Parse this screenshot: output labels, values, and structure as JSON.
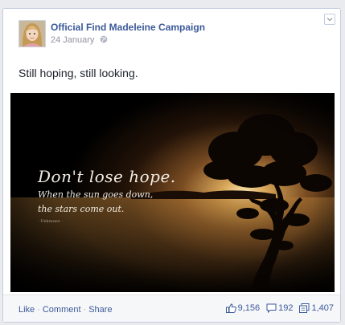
{
  "post": {
    "page_name": "Official Find Madeleine Campaign",
    "date": "24 January",
    "privacy_icon": "globe-icon",
    "message": "Still hoping, still looking.",
    "image_quote": {
      "line1": "Don't lose hope.",
      "line2": "When the sun goes down,",
      "line3": "the stars come out.",
      "attribution": "- Unknown -"
    }
  },
  "footer": {
    "actions": [
      "Like",
      "Comment",
      "Share"
    ],
    "separator": "·",
    "likes": "9,156",
    "comments": "192",
    "shares": "1,407"
  },
  "colors": {
    "link": "#3b5998",
    "muted": "#90949c",
    "background": "#e9ebee"
  }
}
